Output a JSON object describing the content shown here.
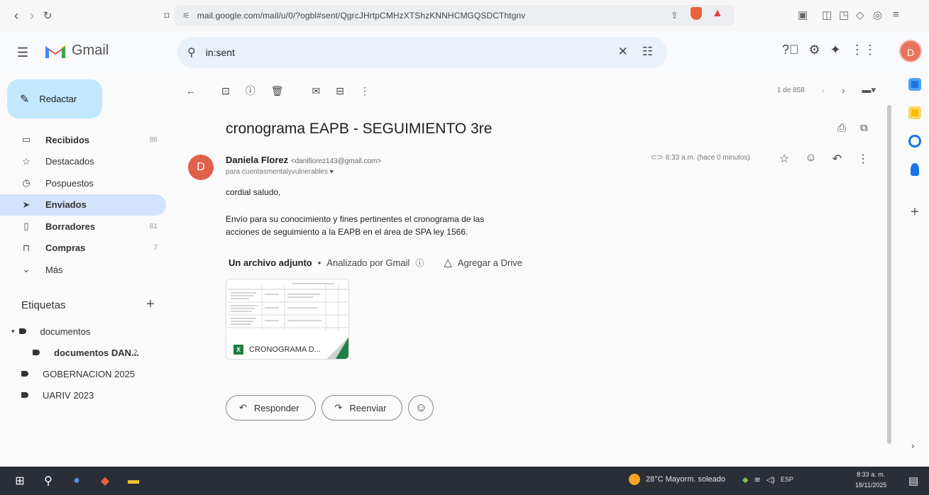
{
  "browser": {
    "url": "mail.google.com/mail/u/0/?ogbl#sent/QgrcJHrtpCMHzXTShzKNNHCMGQSDCThtgnv"
  },
  "app": {
    "name": "Gmail"
  },
  "search": {
    "query": "in:sent"
  },
  "compose": {
    "label": "Redactar"
  },
  "sidebar": {
    "items": [
      {
        "label": "Recibidos",
        "count": "86",
        "icon": "inbox-icon",
        "bold": true
      },
      {
        "label": "Destacados",
        "count": "",
        "icon": "star-icon",
        "bold": false
      },
      {
        "label": "Pospuestos",
        "count": "",
        "icon": "clock-icon",
        "bold": false
      },
      {
        "label": "Enviados",
        "count": "",
        "icon": "send-icon",
        "bold": true,
        "active": true
      },
      {
        "label": "Borradores",
        "count": "81",
        "icon": "draft-icon",
        "bold": true
      },
      {
        "label": "Compras",
        "count": "7",
        "icon": "shopping-bag-icon",
        "bold": true
      },
      {
        "label": "Más",
        "count": "",
        "icon": "chevron-down-icon",
        "bold": false
      }
    ],
    "labels_heading": "Etiquetas",
    "labels": [
      {
        "name": "documentos",
        "count": ""
      },
      {
        "name": "documentos DAN...",
        "count": "2"
      },
      {
        "name": "GOBERNACION 2025",
        "count": ""
      },
      {
        "name": "UARIV 2023",
        "count": ""
      }
    ]
  },
  "pager": {
    "text": "1 de 858"
  },
  "message": {
    "subject": "cronograma EAPB - SEGUIMIENTO 3re",
    "sender_initial": "D",
    "sender_name": "Daniela Florez",
    "sender_email": "<danifiorez143@gmail.com>",
    "recipient": "para cuentasmentalyvulnerables",
    "time": "8:33 a.m. (hace 0 minutos)",
    "greeting": "cordial saludo,",
    "body_line1": "Envío para su conocimiento y fines pertinentes el cronograma de las",
    "body_line2": "acciones de seguimiento a la EAPB en el área de SPA ley 1566.",
    "attachment_heading": "Un archivo adjunto",
    "scanned": "Analizado por Gmail",
    "add_drive": "Agregar a Drive",
    "attachment_name": "CRONOGRAMA D..."
  },
  "actions": {
    "reply": "Responder",
    "forward": "Reenviar"
  },
  "avatar_initial": "D",
  "taskbar": {
    "weather": "28°C  Mayorm. soleado",
    "lang": "ESP",
    "time": "8:33 a. m.",
    "date": "18/11/2025"
  }
}
